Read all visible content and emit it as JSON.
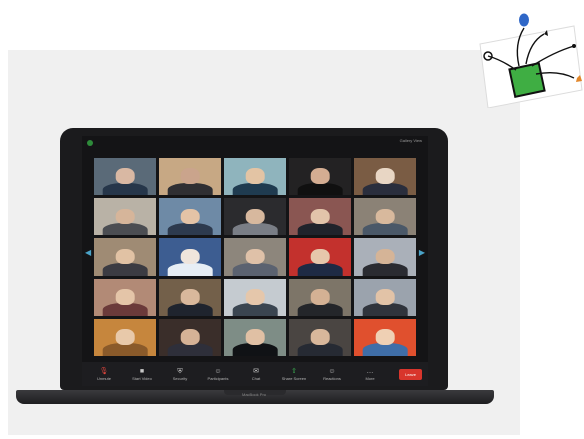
{
  "app": {
    "view_label": "Gallery View",
    "laptop_brand": "MacBook Pro"
  },
  "toolbar": {
    "buttons": [
      {
        "label": "Unmute",
        "icon": "microphone-icon"
      },
      {
        "label": "Start Video",
        "icon": "camera-icon"
      },
      {
        "label": "Security",
        "icon": "shield-icon"
      },
      {
        "label": "Participants",
        "icon": "participants-icon"
      },
      {
        "label": "Chat",
        "icon": "chat-icon"
      },
      {
        "label": "Share Screen",
        "icon": "share-icon"
      },
      {
        "label": "Reactions",
        "icon": "reactions-icon"
      },
      {
        "label": "More",
        "icon": "more-icon"
      }
    ],
    "end_label": "Leave"
  },
  "participants": [
    {
      "bg": "#5a6a78",
      "skin": "#d9b8a3",
      "shirt": "#26364a"
    },
    {
      "bg": "#c7a884",
      "skin": "#caa48c",
      "shirt": "#2f2f33"
    },
    {
      "bg": "#8fb4bd",
      "skin": "#e3c4a4",
      "shirt": "#1f3b50"
    },
    {
      "bg": "#232223",
      "skin": "#d4ad92",
      "shirt": "#101010"
    },
    {
      "bg": "#7a5c44",
      "skin": "#e8d6c4",
      "shirt": "#2a2e3d"
    },
    {
      "bg": "#b9b2a6",
      "skin": "#d6b59a",
      "shirt": "#4b4d52"
    },
    {
      "bg": "#6e8aa6",
      "skin": "#e4c3a6",
      "shirt": "#2d3a4e"
    },
    {
      "bg": "#2b2b2e",
      "skin": "#d7b89e",
      "shirt": "#7a7e86"
    },
    {
      "bg": "#8a5652",
      "skin": "#e2c4aa",
      "shirt": "#20232b"
    },
    {
      "bg": "#8b8276",
      "skin": "#d8b99d",
      "shirt": "#4a5868"
    },
    {
      "bg": "#9f8b74",
      "skin": "#e1c2a4",
      "shirt": "#3b3b42"
    },
    {
      "bg": "#3d5d91",
      "skin": "#efe5dc",
      "shirt": "#e7eef5"
    },
    {
      "bg": "#8d867c",
      "skin": "#dfc1a8",
      "shirt": "#5b6270"
    },
    {
      "bg": "#c3312d",
      "skin": "#e6c7ab",
      "shirt": "#1e2a44"
    },
    {
      "bg": "#aab0b9",
      "skin": "#d5b497",
      "shirt": "#2a2b31"
    },
    {
      "bg": "#b28a76",
      "skin": "#e4c5a8",
      "shirt": "#6b3a3a"
    },
    {
      "bg": "#73604a",
      "skin": "#d9b89c",
      "shirt": "#1f242e"
    },
    {
      "bg": "#c5cbd0",
      "skin": "#e5c7ab",
      "shirt": "#3a4550"
    },
    {
      "bg": "#7d7568",
      "skin": "#d4b194",
      "shirt": "#24262a"
    },
    {
      "bg": "#9ba3ad",
      "skin": "#e2c3a7",
      "shirt": "#30343c"
    },
    {
      "bg": "#c6863d",
      "skin": "#e8c9aa",
      "shirt": "#8a5a2a"
    },
    {
      "bg": "#3a2e2a",
      "skin": "#d5b296",
      "shirt": "#2e2f3a"
    },
    {
      "bg": "#7e8d86",
      "skin": "#e0c0a4",
      "shirt": "#101215"
    },
    {
      "bg": "#4a4542",
      "skin": "#d8b79b",
      "shirt": "#262a33"
    },
    {
      "bg": "#e0502e",
      "skin": "#efd0b4",
      "shirt": "#3f6ea8"
    }
  ],
  "colors": {
    "accent_green": "#3fbf57",
    "end_red": "#d8352c",
    "arrow_blue": "#4aa3c8"
  }
}
